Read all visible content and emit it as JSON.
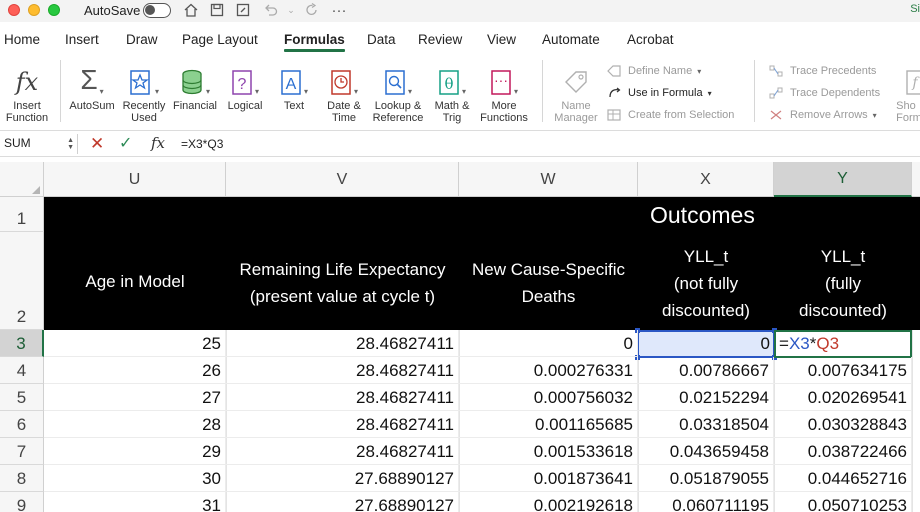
{
  "titlebar": {
    "autosave_label": "AutoSave",
    "right_text": "Si"
  },
  "tabs": [
    "Home",
    "Insert",
    "Draw",
    "Page Layout",
    "Formulas",
    "Data",
    "Review",
    "View",
    "Automate",
    "Acrobat"
  ],
  "active_tab": "Formulas",
  "ribbon": {
    "insert_function": "Insert\nFunction",
    "autosum": "AutoSum",
    "recently_used": "Recently\nUsed",
    "financial": "Financial",
    "logical": "Logical",
    "text": "Text",
    "date_time": "Date &\nTime",
    "lookup": "Lookup &\nReference",
    "math": "Math &\nTrig",
    "more": "More\nFunctions",
    "name_manager": "Name\nManager",
    "define_name": "Define Name",
    "use_in_formula": "Use in Formula",
    "create_from_selection": "Create from Selection",
    "trace_precedents": "Trace Precedents",
    "trace_dependents": "Trace Dependents",
    "remove_arrows": "Remove Arrows",
    "show_formulas": "Sho\nFormu"
  },
  "formula_bar": {
    "name_box": "SUM",
    "formula": "=X3*Q3"
  },
  "columns": [
    "U",
    "V",
    "W",
    "X",
    "Y"
  ],
  "selected_column": "Y",
  "rows": [
    "1",
    "2",
    "3",
    "4",
    "5",
    "6",
    "7",
    "8",
    "9"
  ],
  "selected_row": "3",
  "header": {
    "outcomes": "Outcomes",
    "age": "Age in Model",
    "life_exp_1": "Remaining Life Expectancy",
    "life_exp_2": "(present value at cycle t)",
    "deaths_1": "New Cause-Specific",
    "deaths_2": "Deaths",
    "yll_nf_1": "YLL_t",
    "yll_nf_2": "(not fully",
    "yll_nf_3": "discounted)",
    "yll_f_1": "YLL_t",
    "yll_f_2": "(fully",
    "yll_f_3": "discounted)"
  },
  "editing_cell": {
    "eq": "=",
    "ref1": "X3",
    "op": "*",
    "ref2": "Q3"
  },
  "table": [
    {
      "u": "25",
      "v": "28.46827411",
      "w": "0",
      "x": "0",
      "y": ""
    },
    {
      "u": "26",
      "v": "28.46827411",
      "w": "0.000276331",
      "x": "0.00786667",
      "y": "0.007634175"
    },
    {
      "u": "27",
      "v": "28.46827411",
      "w": "0.000756032",
      "x": "0.02152294",
      "y": "0.020269541"
    },
    {
      "u": "28",
      "v": "28.46827411",
      "w": "0.001165685",
      "x": "0.03318504",
      "y": "0.030328843"
    },
    {
      "u": "29",
      "v": "28.46827411",
      "w": "0.001533618",
      "x": "0.043659458",
      "y": "0.038722466"
    },
    {
      "u": "30",
      "v": "27.68890127",
      "w": "0.001873641",
      "x": "0.051879055",
      "y": "0.044652716"
    },
    {
      "u": "31",
      "v": "27.68890127",
      "w": "0.002192618",
      "x": "0.060711195",
      "y": "0.050710253"
    }
  ]
}
